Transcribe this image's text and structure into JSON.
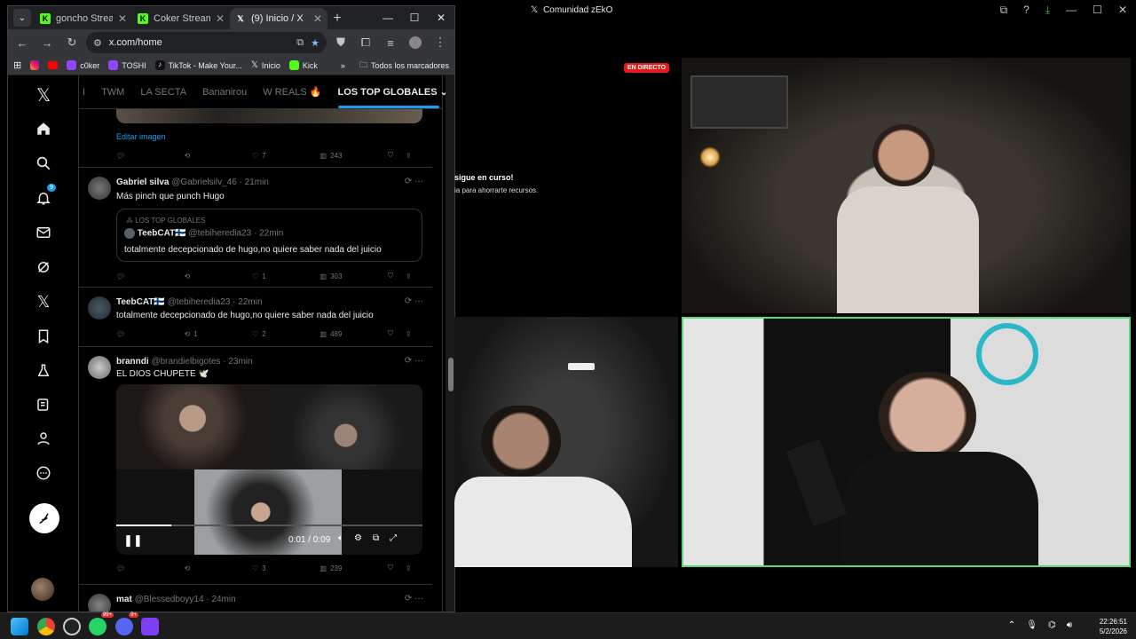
{
  "browser": {
    "tabs": [
      {
        "title": "goncho Stream -",
        "favicon": "kick-icon",
        "color": "#53fc18"
      },
      {
        "title": "Coker Stream - W",
        "favicon": "kick-icon",
        "color": "#53fc18"
      },
      {
        "title": "(9) Inicio / X",
        "favicon": "x-icon",
        "color": "#ffffff",
        "active": true
      }
    ],
    "url": "x.com/home",
    "bookmarks": [
      {
        "label": "c0ker",
        "icon": "twitch-icon",
        "color": "#9146ff"
      },
      {
        "label": "TOSHI",
        "icon": "twitch-icon",
        "color": "#9146ff"
      },
      {
        "label": "TikTok - Make Your...",
        "icon": "tiktok-icon",
        "color": "#111"
      },
      {
        "label": "Inicio",
        "icon": "x-icon",
        "color": "#000"
      },
      {
        "label": "Kick",
        "icon": "kick-icon",
        "color": "#53fc18"
      }
    ],
    "more_bookmarks": "»",
    "all_bookmarks": "Todos los marcadores"
  },
  "x": {
    "notification_count": "9",
    "feed_tabs": [
      "I",
      "TWM",
      "LA SECTA",
      "Bananirou",
      "W REALS 🔥",
      "LOS TOP GLOBALES"
    ],
    "edit_image": "Editar imagen",
    "post0": {
      "replies": "",
      "reposts": "",
      "likes": "7",
      "views": "243"
    },
    "post1": {
      "name": "Gabriel silva",
      "handle": "@Gabrielsilv_46 · 21min",
      "text": "Más pinch que punch Hugo",
      "quote_community": "LOS TOP GLOBALES",
      "quote_name": "TeebCAT🇫🇮",
      "quote_handle": "@tebiheredia23 · 22min",
      "quote_text": "totalmente decepcionado de hugo,no quiere saber nada del juicio",
      "replies": "",
      "reposts": "",
      "likes": "1",
      "views": "303"
    },
    "post2": {
      "name": "TeebCAT🇫🇮",
      "handle": "@tebiheredia23 · 22min",
      "text": "totalmente decepcionado de hugo,no quiere saber nada del juicio",
      "replies": "",
      "reposts": "1",
      "likes": "2",
      "views": "489"
    },
    "post3": {
      "name": "branndi",
      "handle": "@brandielbigotes · 23min",
      "text": "EL DIOS CHUPETE 🕊️",
      "video_time": "0:01 / 0:09",
      "replies": "",
      "reposts": "",
      "likes": "3",
      "views": "239"
    },
    "post4": {
      "name": "mat",
      "handle": "@Blessedboyy14 · 24min"
    }
  },
  "stream": {
    "title": "Comunidad zEkO",
    "live": "EN DIRECTO",
    "notice_title": "sigue en curso!",
    "notice_sub": "ia para ahorrarte recursos."
  },
  "taskbar": {
    "time": "22:26:51",
    "date": "5/2/2026",
    "badge_whatsapp": "99+",
    "badge_discord": "9+"
  }
}
